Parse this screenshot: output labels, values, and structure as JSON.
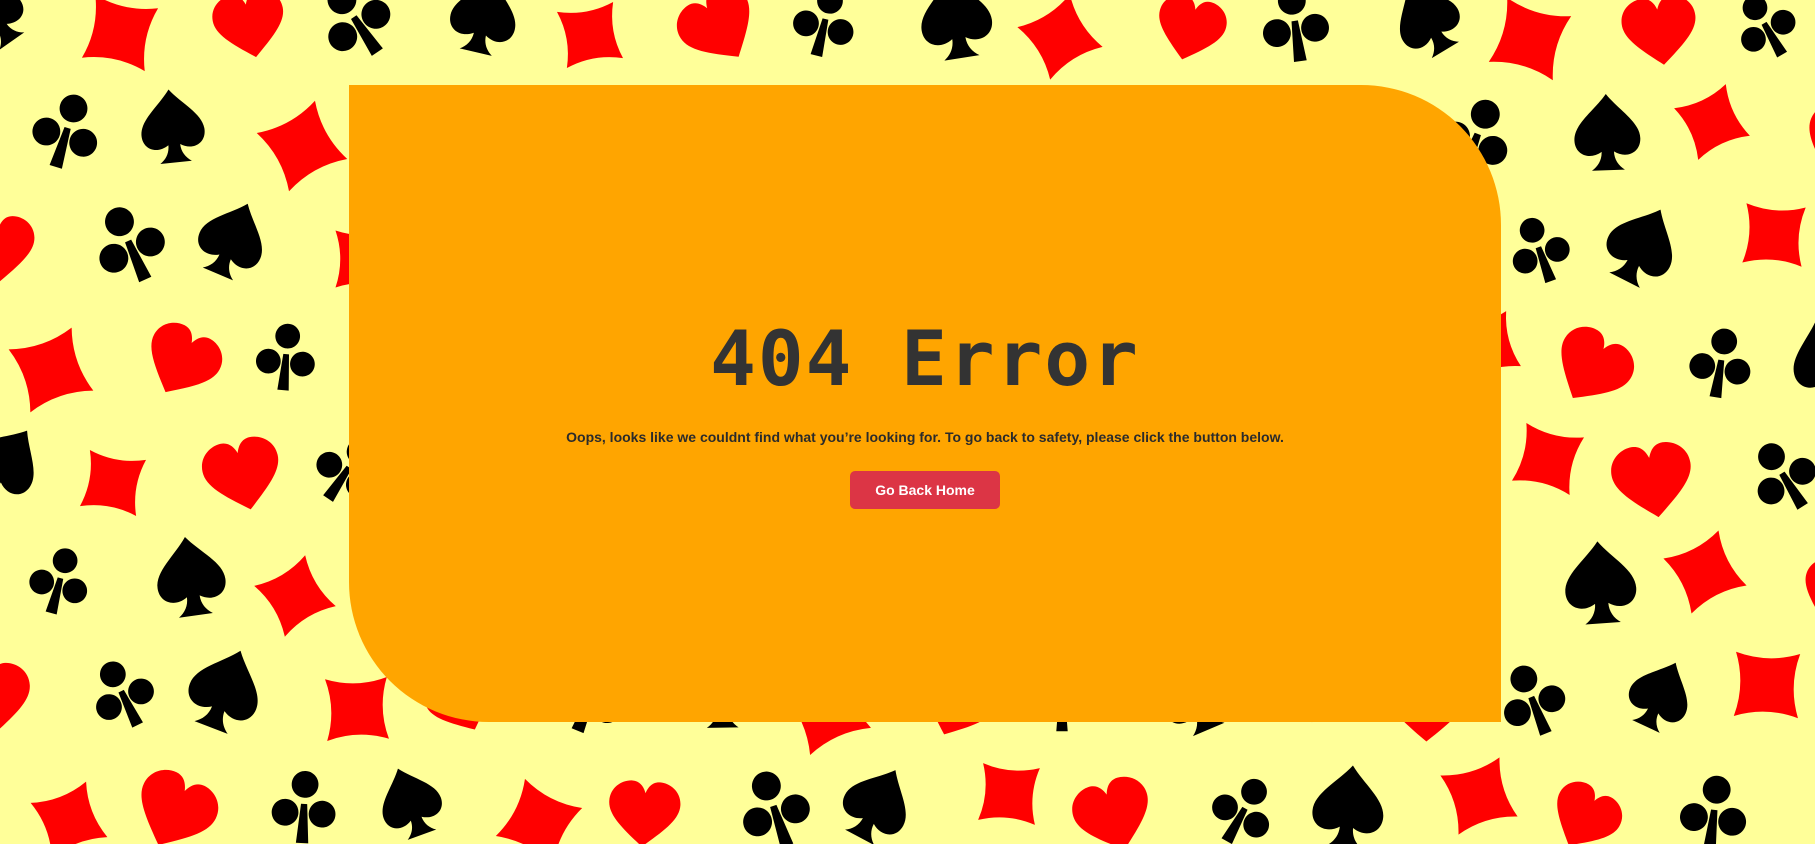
{
  "background": {
    "color": "#ffff99",
    "pattern_icons": [
      "spade-icon",
      "heart-icon",
      "diamond-icon",
      "club-icon"
    ],
    "suit_colors": {
      "black": "#000000",
      "red": "#ff0000"
    }
  },
  "card": {
    "color": "#ffa500"
  },
  "error": {
    "title": "404 Error",
    "message": "Oops, looks like we couldnt find what you’re looking for. To go back to safety, please click the button below.",
    "button_label": "Go Back Home",
    "button_color": "#dc3545"
  }
}
